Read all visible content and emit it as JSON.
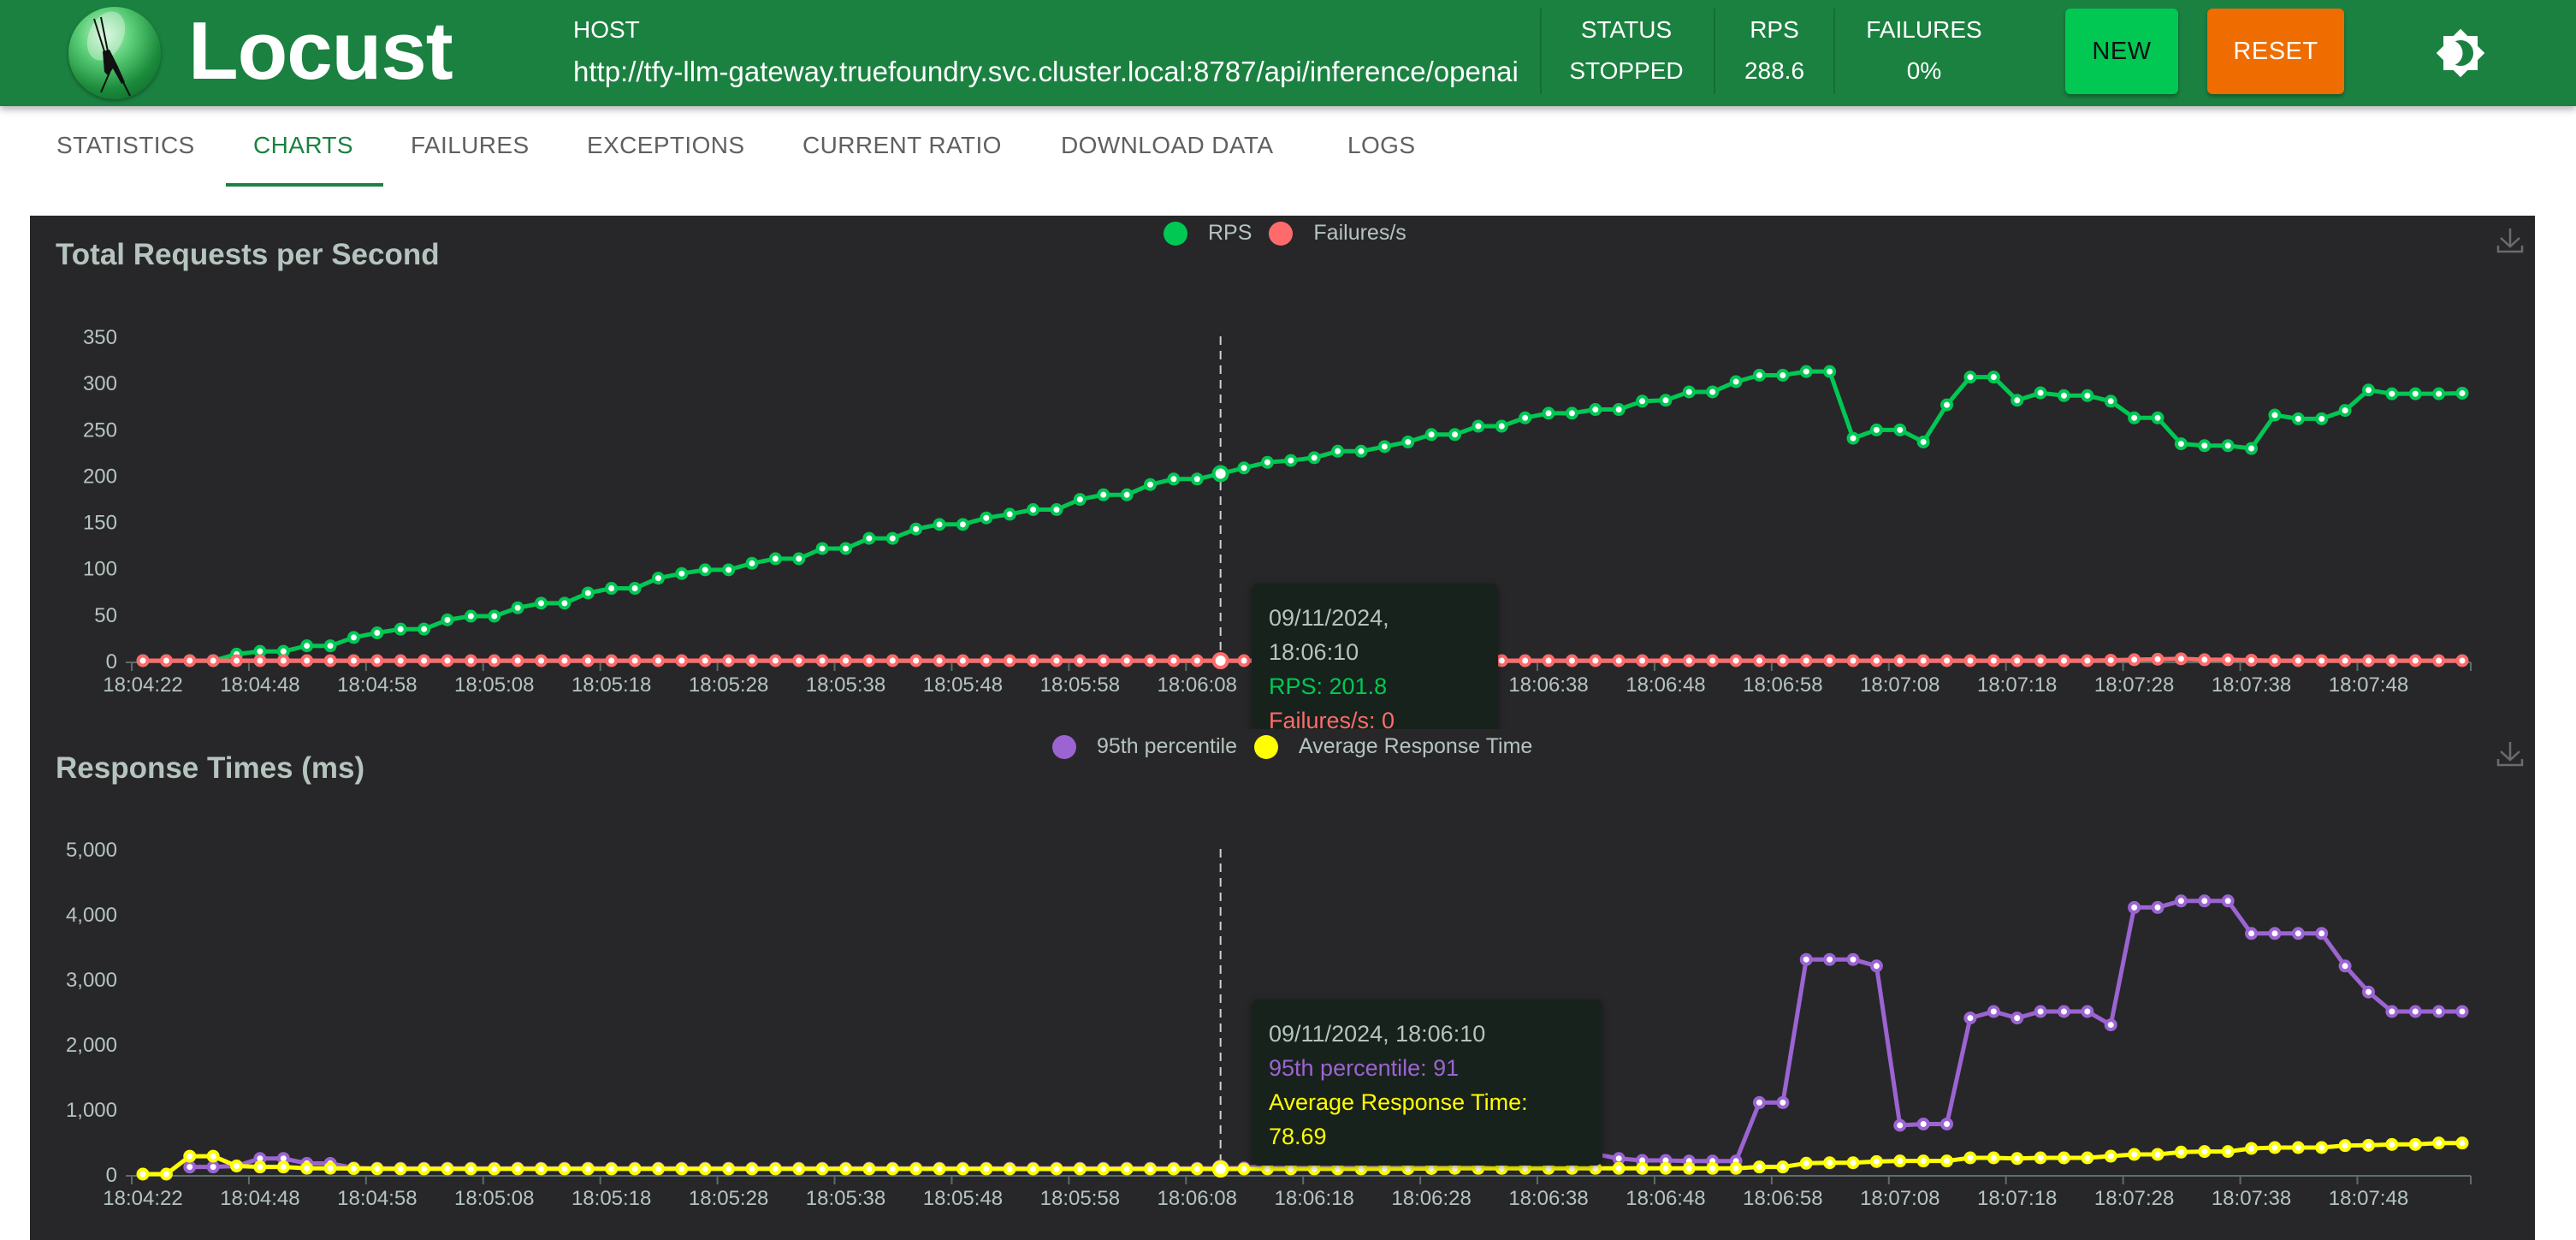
{
  "header": {
    "brand": "Locust",
    "host_label": "HOST",
    "host_value": "http://tfy-llm-gateway.truefoundry.svc.cluster.local:8787/api/inference/openai",
    "stats": [
      {
        "label": "STATUS",
        "value": "STOPPED"
      },
      {
        "label": "RPS",
        "value": "288.6"
      },
      {
        "label": "FAILURES",
        "value": "0%"
      }
    ],
    "new_button": "NEW",
    "reset_button": "RESET",
    "theme_icon": "brightness-icon"
  },
  "tabs": [
    {
      "label": "STATISTICS",
      "active": false
    },
    {
      "label": "CHARTS",
      "active": true
    },
    {
      "label": "FAILURES",
      "active": false
    },
    {
      "label": "EXCEPTIONS",
      "active": false
    },
    {
      "label": "CURRENT RATIO",
      "active": false
    },
    {
      "label": "DOWNLOAD DATA",
      "active": false
    },
    {
      "label": "LOGS",
      "active": false
    }
  ],
  "colors": {
    "brand": "#1b8140",
    "new_button": "#00c853",
    "reset_button": "#ef6c00",
    "rps": "#00c853",
    "failures": "#ff6b6b",
    "p95": "#9c64d2",
    "avg": "#ffff00"
  },
  "chart_data": [
    {
      "type": "line",
      "title": "Total Requests per Second",
      "xlabel": "",
      "ylabel": "",
      "ylim": [
        0,
        350
      ],
      "yticks": [
        "0",
        "50",
        "100",
        "150",
        "200",
        "250",
        "300",
        "350"
      ],
      "xtick_labels": [
        "18:04:22",
        "18:04:48",
        "18:04:58",
        "18:05:08",
        "18:05:18",
        "18:05:28",
        "18:05:38",
        "18:05:48",
        "18:05:58",
        "18:06:08",
        "18:06:18",
        "18:06:28",
        "18:06:38",
        "18:06:48",
        "18:06:58",
        "18:07:08",
        "18:07:18",
        "18:07:28",
        "18:07:38",
        "18:07:48"
      ],
      "legend": "top-center",
      "series": [
        {
          "name": "RPS",
          "color": "#00c853",
          "values": [
            0,
            0,
            0,
            0,
            7,
            10,
            10,
            16,
            16,
            25,
            30,
            34,
            34,
            44,
            48,
            48,
            57,
            62,
            62,
            73,
            78,
            78,
            89,
            94,
            98,
            98,
            105,
            110,
            110,
            121,
            121,
            132,
            132,
            142,
            147,
            147,
            154,
            158,
            163,
            163,
            174,
            179,
            179,
            190,
            196,
            196,
            201.8,
            208,
            214,
            216,
            219,
            226,
            226,
            231,
            236,
            244,
            244,
            253,
            253,
            262,
            267,
            267,
            271,
            271,
            280,
            281,
            290,
            290,
            301,
            308,
            308,
            312,
            312,
            240,
            249,
            249,
            236,
            276,
            306,
            306,
            281,
            289,
            286,
            286,
            280,
            262,
            262,
            234,
            232,
            232,
            229,
            265,
            261,
            261,
            270,
            292,
            288,
            288,
            288,
            288.6
          ]
        },
        {
          "name": "Failures/s",
          "color": "#ff6b6b",
          "values": [
            0,
            0,
            0,
            0,
            0,
            0,
            0,
            0,
            0,
            0,
            0,
            0,
            0,
            0,
            0,
            0,
            0,
            0,
            0,
            0,
            0,
            0,
            0,
            0,
            0,
            0,
            0,
            0,
            0,
            0,
            0,
            0,
            0,
            0,
            0,
            0,
            0,
            0,
            0,
            0,
            0,
            0,
            0,
            0,
            0,
            0,
            0,
            0,
            0,
            0,
            0,
            0,
            0,
            0,
            0,
            0,
            0,
            0,
            0,
            0,
            0,
            0,
            0,
            0,
            0,
            0,
            0,
            0,
            0,
            0,
            0,
            0,
            0,
            0,
            0,
            0,
            0,
            0,
            0,
            0,
            0,
            0,
            0,
            0,
            0.5,
            1,
            1.5,
            2,
            1,
            1,
            0.5,
            0,
            0,
            0,
            0,
            0,
            0,
            0,
            0,
            0
          ]
        }
      ],
      "tooltip": {
        "index": 46,
        "timestamp": "09/11/2024, 18:06:10",
        "lines": [
          "RPS: 201.8",
          "Failures/s: 0"
        ]
      }
    },
    {
      "type": "line",
      "title": "Response Times (ms)",
      "xlabel": "",
      "ylabel": "",
      "ylim": [
        0,
        5000
      ],
      "yticks": [
        "0",
        "1,000",
        "2,000",
        "3,000",
        "4,000",
        "5,000"
      ],
      "xtick_labels": [
        "18:04:22",
        "18:04:48",
        "18:04:58",
        "18:05:08",
        "18:05:18",
        "18:05:28",
        "18:05:38",
        "18:05:48",
        "18:05:58",
        "18:06:08",
        "18:06:18",
        "18:06:28",
        "18:06:38",
        "18:06:48",
        "18:06:58",
        "18:07:08",
        "18:07:18",
        "18:07:28",
        "18:07:38",
        "18:07:48"
      ],
      "legend": "top-center",
      "series": [
        {
          "name": "95th percentile",
          "color": "#9c64d2",
          "values": [
            null,
            null,
            110,
            110,
            125,
            240,
            240,
            165,
            165,
            95,
            90,
            90,
            90,
            90,
            90,
            90,
            90,
            90,
            90,
            90,
            90,
            90,
            90,
            90,
            90,
            90,
            90,
            90,
            90,
            90,
            90,
            90,
            90,
            90,
            90,
            90,
            90,
            90,
            90,
            90,
            90,
            90,
            90,
            90,
            90,
            90,
            91,
            95,
            130,
            130,
            130,
            130,
            130,
            130,
            130,
            130,
            150,
            150,
            175,
            175,
            307,
            307,
            307,
            240,
            210,
            210,
            200,
            200,
            200,
            1100,
            1100,
            3300,
            3300,
            3300,
            3200,
            750,
            770,
            770,
            2400,
            2500,
            2400,
            2500,
            2500,
            2500,
            2295,
            4100,
            4100,
            4200,
            4200,
            4200,
            3700,
            3700,
            3700,
            3700,
            3200,
            2800,
            2500,
            2500,
            2500,
            2500
          ]
        },
        {
          "name": "Average Response Time",
          "color": "#ffff00",
          "values": [
            0,
            0,
            275,
            275,
            125,
            110,
            110,
            90,
            90,
            85,
            82,
            80,
            80,
            80,
            80,
            80,
            80,
            80,
            80,
            80,
            80,
            80,
            80,
            80,
            80,
            80,
            80,
            80,
            80,
            80,
            80,
            80,
            80,
            80,
            80,
            80,
            80,
            79,
            79,
            79,
            79,
            79,
            79,
            79,
            79,
            79,
            78.69,
            79,
            80,
            80,
            80,
            80,
            80,
            82,
            84,
            86,
            88,
            88,
            88,
            88,
            88,
            88,
            88,
            88,
            88,
            88,
            88,
            88,
            88,
            110,
            110,
            167,
            175,
            175,
            193,
            202,
            202,
            202,
            250,
            250,
            240,
            250,
            250,
            250,
            276,
            303,
            303,
            338,
            347,
            347,
            395,
            408,
            408,
            408,
            439,
            443,
            456,
            456,
            478,
            478
          ]
        }
      ],
      "tooltip": {
        "index": 46,
        "timestamp": "09/11/2024, 18:06:10",
        "lines": [
          "95th percentile: 91",
          "Average Response Time: 78.69"
        ]
      }
    }
  ]
}
